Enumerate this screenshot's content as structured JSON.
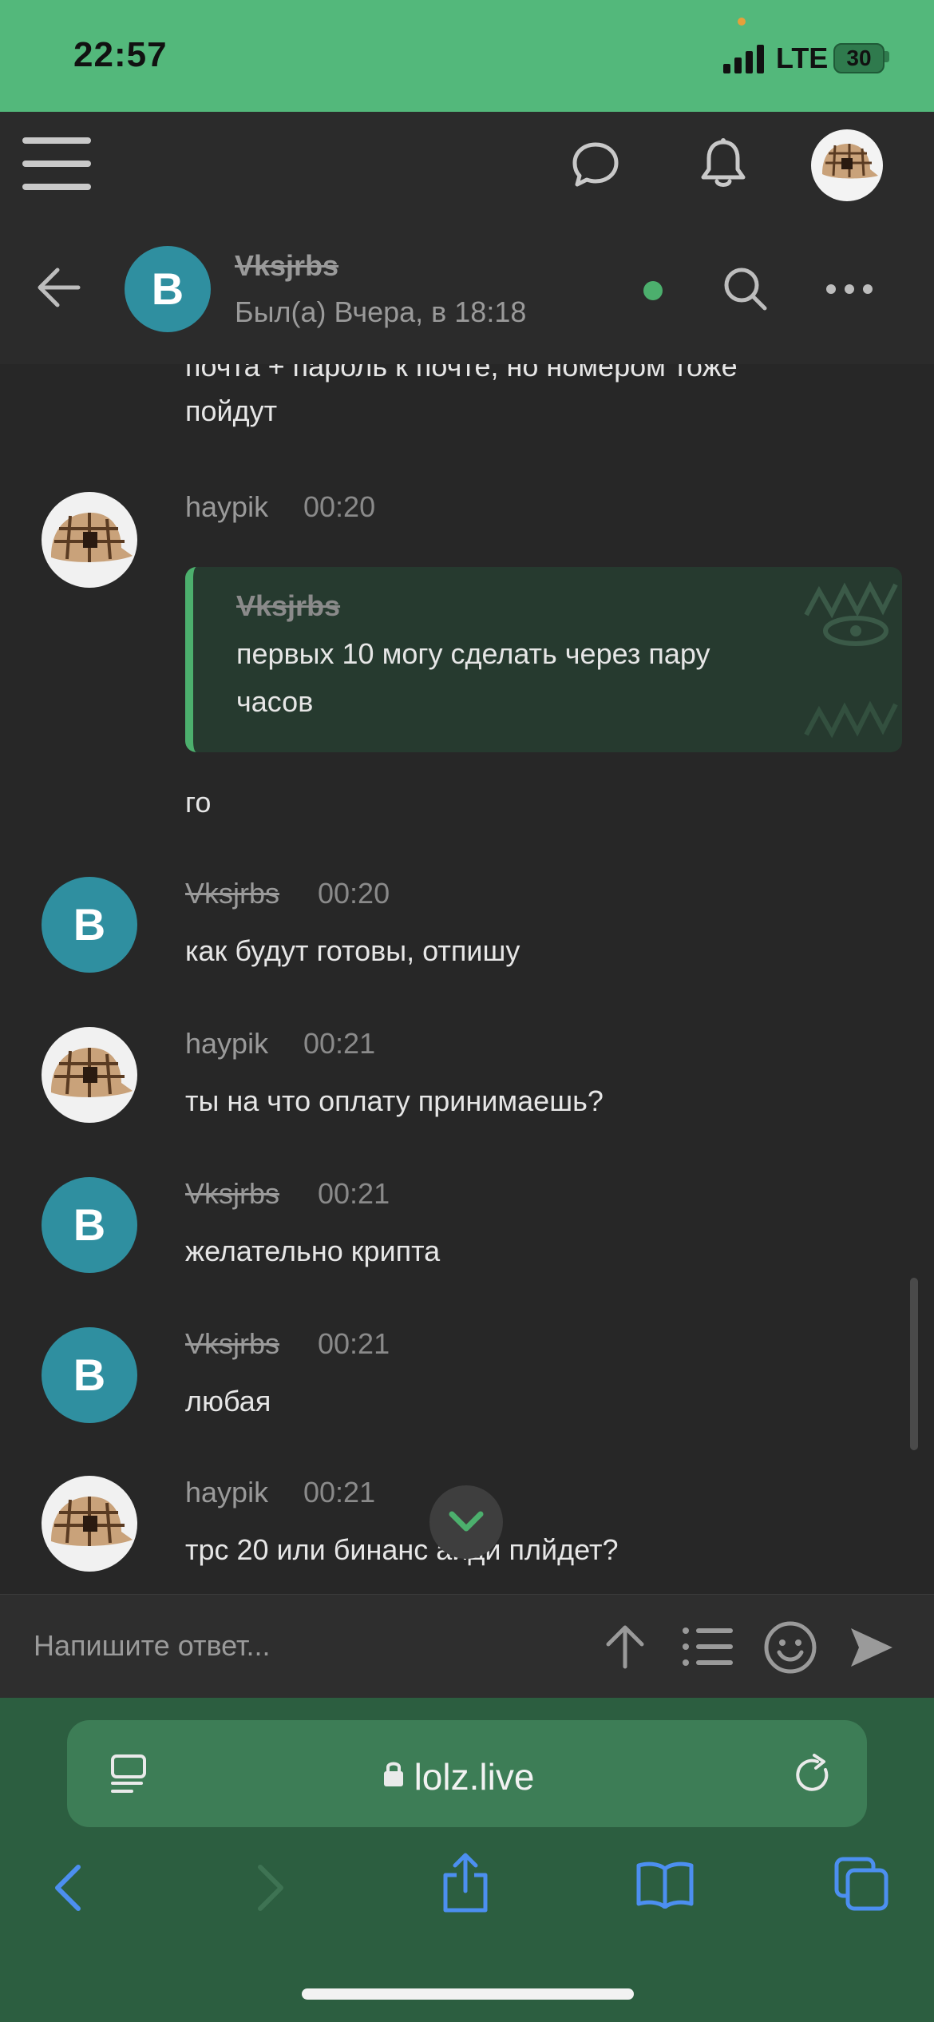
{
  "status_bar": {
    "time": "22:57",
    "network": "LTE",
    "battery": "30"
  },
  "site_header": {
    "menu_icon": "menu-icon",
    "chat_icon": "chat-bubble-icon",
    "bell_icon": "bell-icon",
    "avatar_icon": "burberry-cap-avatar"
  },
  "chat_header": {
    "back_icon": "arrow-left-icon",
    "avatar_letter": "B",
    "name": "Vksjrbs",
    "status": "Был(а) Вчера, в 18:18",
    "online_color": "#4caf6d",
    "search_icon": "search-icon",
    "more_icon": "more-dots-icon"
  },
  "messages": {
    "partial_top_line1": "почта + пароль к почте, но номером тоже",
    "partial_top_line2": "пойдут",
    "items": [
      {
        "author": "haypik",
        "time": "00:20",
        "quote": {
          "author": "Vksjrbs",
          "line1": "первых 10 могу сделать через пару",
          "line2": "часов"
        },
        "text": "го"
      },
      {
        "author": "Vksjrbs",
        "time": "00:20",
        "text": "как будут готовы, отпишу"
      },
      {
        "author": "haypik",
        "time": "00:21",
        "text": "ты на что оплату принимаешь?"
      },
      {
        "author": "Vksjrbs",
        "time": "00:21",
        "text": "желательно крипта"
      },
      {
        "author": "Vksjrbs",
        "time": "00:21",
        "text": "любая"
      },
      {
        "author": "haypik",
        "time": "00:21",
        "text": "трс 20 или бинанс айди плйдет?"
      }
    ]
  },
  "composer": {
    "placeholder": "Напишите ответ...",
    "upload_icon": "arrow-up-icon",
    "list_icon": "list-icon",
    "emoji_icon": "smiley-icon",
    "send_icon": "send-icon"
  },
  "browser": {
    "url": "lolz.live",
    "reader_icon": "reader-mode-icon",
    "lock_icon": "lock-icon",
    "reload_icon": "reload-icon",
    "back_icon": "chevron-left-icon",
    "forward_icon": "chevron-right-icon",
    "share_icon": "share-icon",
    "bookmarks_icon": "book-icon",
    "tabs_icon": "tabs-icon"
  },
  "colors": {
    "status_bar": "#53b87b",
    "background": "#272727",
    "accent_green": "#4caf6d",
    "avatar_teal": "#2f8fa0",
    "browser_bar": "#2c5e40"
  }
}
